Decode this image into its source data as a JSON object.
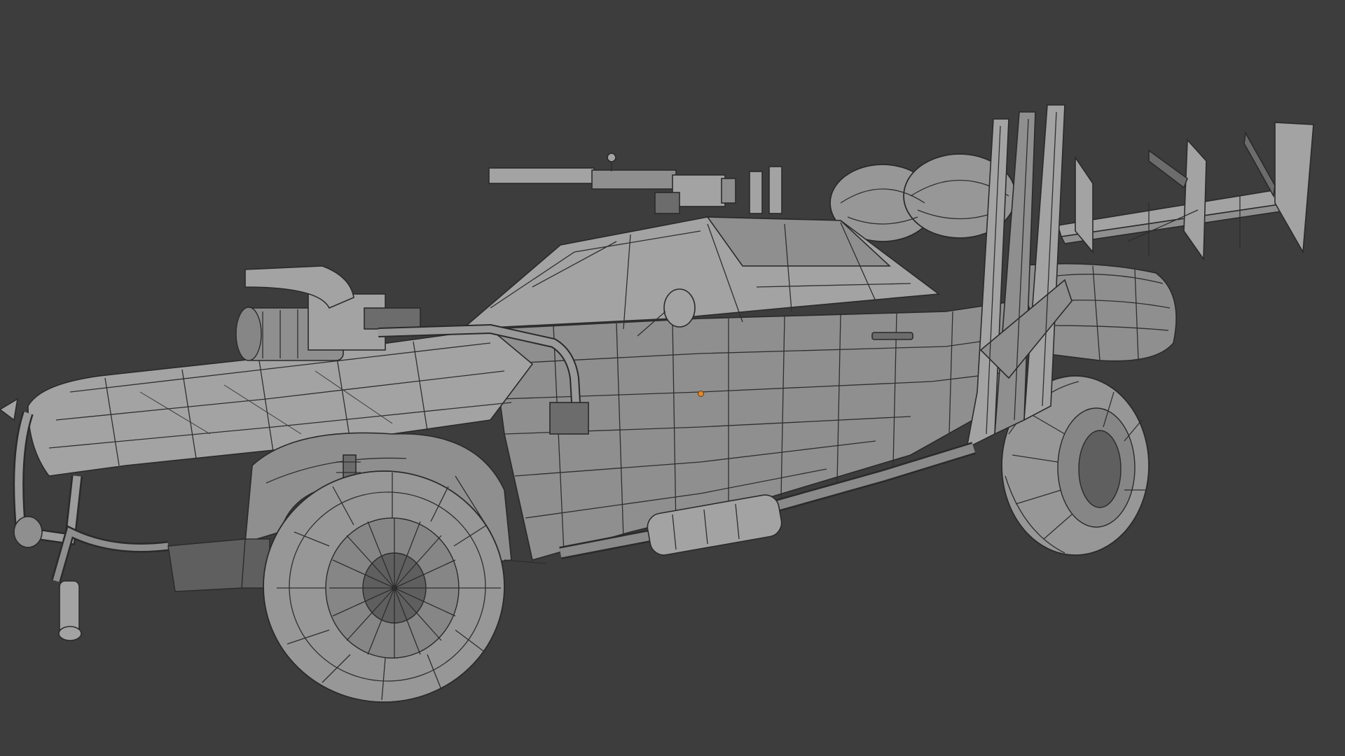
{
  "viewport": {
    "background": "#3d3d3d",
    "shading_mode": "solid-wireframe",
    "object_origin_color": "#e0892a"
  },
  "model": {
    "body_color": "#8f8f8f",
    "wire_color": "#2e2e2e"
  }
}
